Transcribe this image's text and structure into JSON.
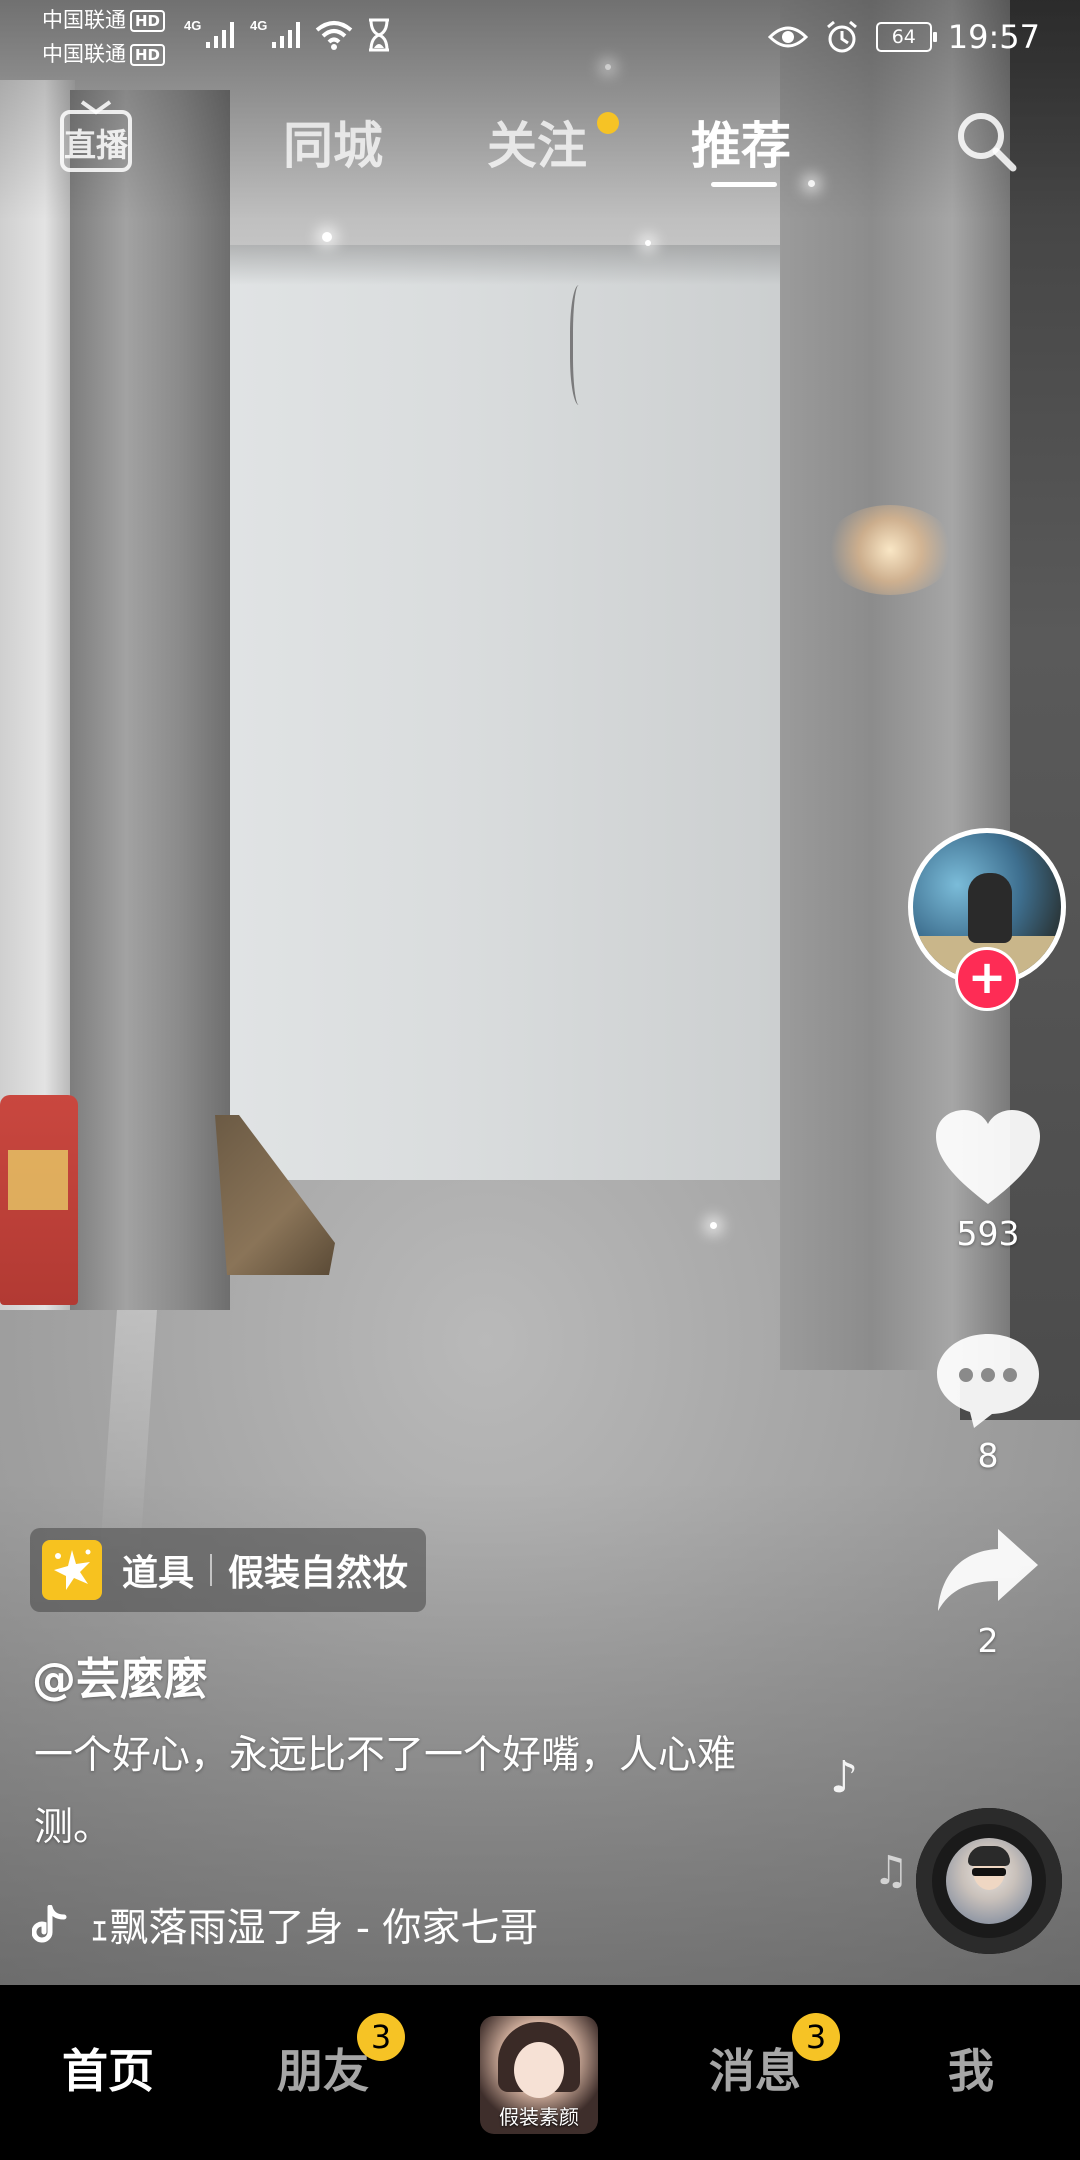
{
  "status_bar": {
    "carrier_1": "中国联通",
    "carrier_2": "中国联通",
    "hd": "HD",
    "network_1": "4G",
    "network_2": "4G",
    "battery": "64",
    "time": "19:57"
  },
  "top_nav": {
    "live_label": "直播",
    "tabs": [
      {
        "label": "同城"
      },
      {
        "label": "关注"
      },
      {
        "label": "推荐"
      }
    ],
    "active_tab": "推荐",
    "follow_dot_color": "#f6c325"
  },
  "actions": {
    "likes": "593",
    "comments": "8",
    "shares": "2",
    "follow_button_color": "#fe2c55"
  },
  "video_info": {
    "prop_label": "道具",
    "prop_name": "假装自然妆",
    "username": "@芸麼麼",
    "caption": "一个好心，永远比不了一个好嘴，人心难测。",
    "music": "ｪ飘落雨湿了身 - 你家七哥"
  },
  "bottom_nav": {
    "items": [
      {
        "label": "首页"
      },
      {
        "label": "朋友",
        "badge": "3"
      },
      {
        "label": "消息",
        "badge": "3"
      },
      {
        "label": "我"
      }
    ],
    "center_label": "假装素颜",
    "active": "首页",
    "badge_color": "#f6c325"
  }
}
